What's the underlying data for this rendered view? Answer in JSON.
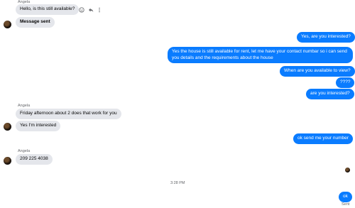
{
  "conversation": {
    "sender_name": "Angela",
    "messages": [
      {
        "id": "m1",
        "text": "Hello, is this still available?"
      },
      {
        "id": "m2",
        "text": "Message sent"
      },
      {
        "id": "m3",
        "text": "Yes, are you interested?"
      },
      {
        "id": "m4",
        "text": "Yes the house is still available for rent, let me have your contact numbar so i can send you details and the requirements about the house"
      },
      {
        "id": "m5",
        "text": "When are you available to view?"
      },
      {
        "id": "m6",
        "text": "????"
      },
      {
        "id": "m7",
        "text": "are you interested?"
      },
      {
        "id": "m8",
        "text": "Friday afternoon about 2 does that work for you"
      },
      {
        "id": "m9",
        "text": "Yes I'm interested"
      },
      {
        "id": "m10",
        "text": "ok send me your number"
      },
      {
        "id": "m11",
        "text": "209 225 4038"
      },
      {
        "id": "m12",
        "text": "ok"
      }
    ],
    "timestamp": "3:28 PM",
    "delivery_status": "Sent"
  },
  "icons": {
    "react": "smile-icon",
    "reply": "reply-icon",
    "more": "more-options-icon"
  }
}
